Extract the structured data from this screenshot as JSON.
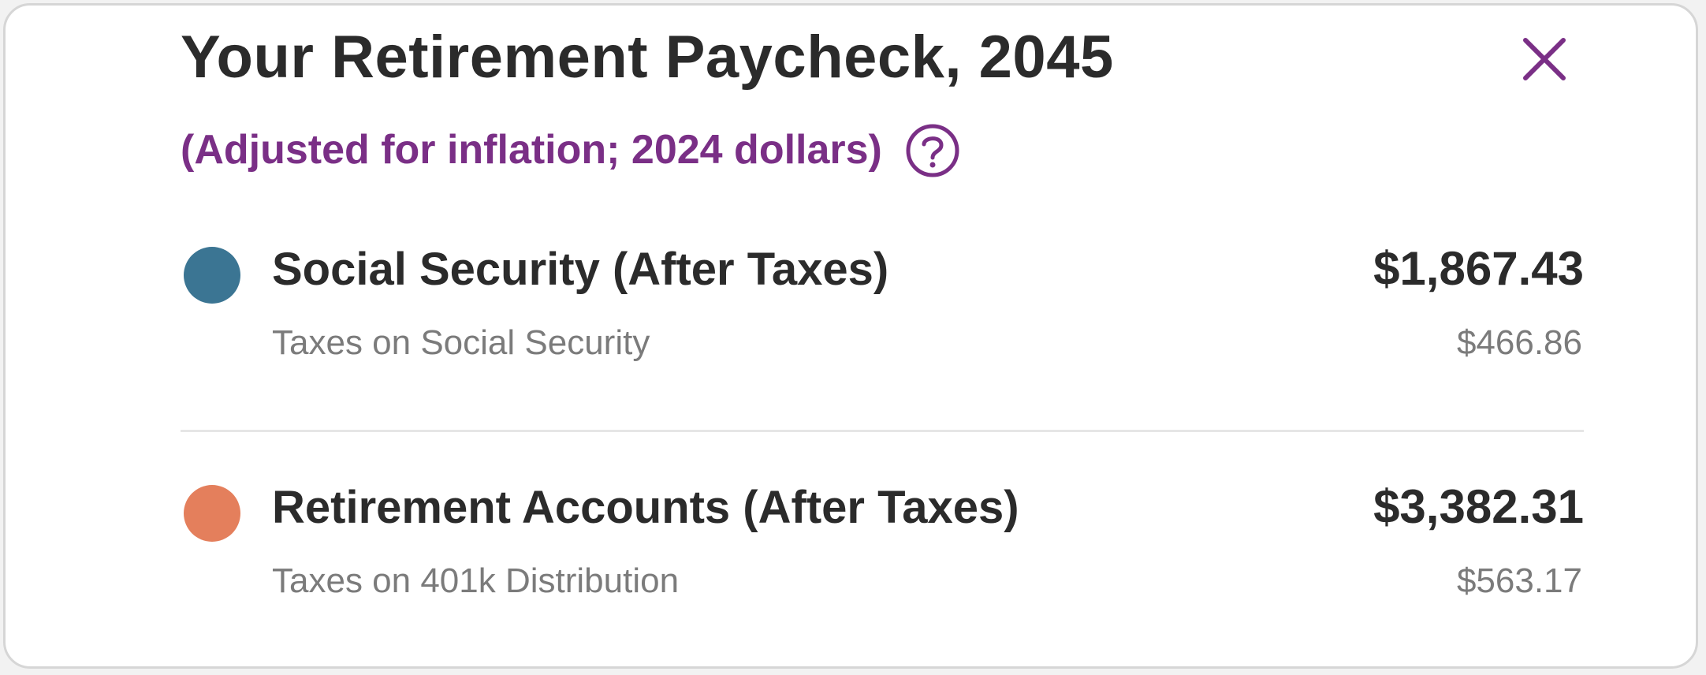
{
  "header": {
    "title": "Your Retirement Paycheck, 2045",
    "subtitle": "(Adjusted for inflation; 2024 dollars)",
    "help_icon": "question-circle-icon",
    "close_icon": "close-x-icon"
  },
  "colors": {
    "title": "#2b2b2b",
    "accent": "#7a2f86",
    "social_security": "#3b7593",
    "retirement_accounts": "#e47f5c",
    "muted_text": "#7b7b7b",
    "divider": "#e6e6e6"
  },
  "rows": [
    {
      "label": "Social Security (After Taxes)",
      "amount": "$1,867.43",
      "sublabel": "Taxes on Social Security",
      "subamount": "$466.86"
    },
    {
      "label": "Retirement Accounts (After Taxes)",
      "amount": "$3,382.31",
      "sublabel": "Taxes on 401k Distribution",
      "subamount": "$563.17"
    }
  ]
}
